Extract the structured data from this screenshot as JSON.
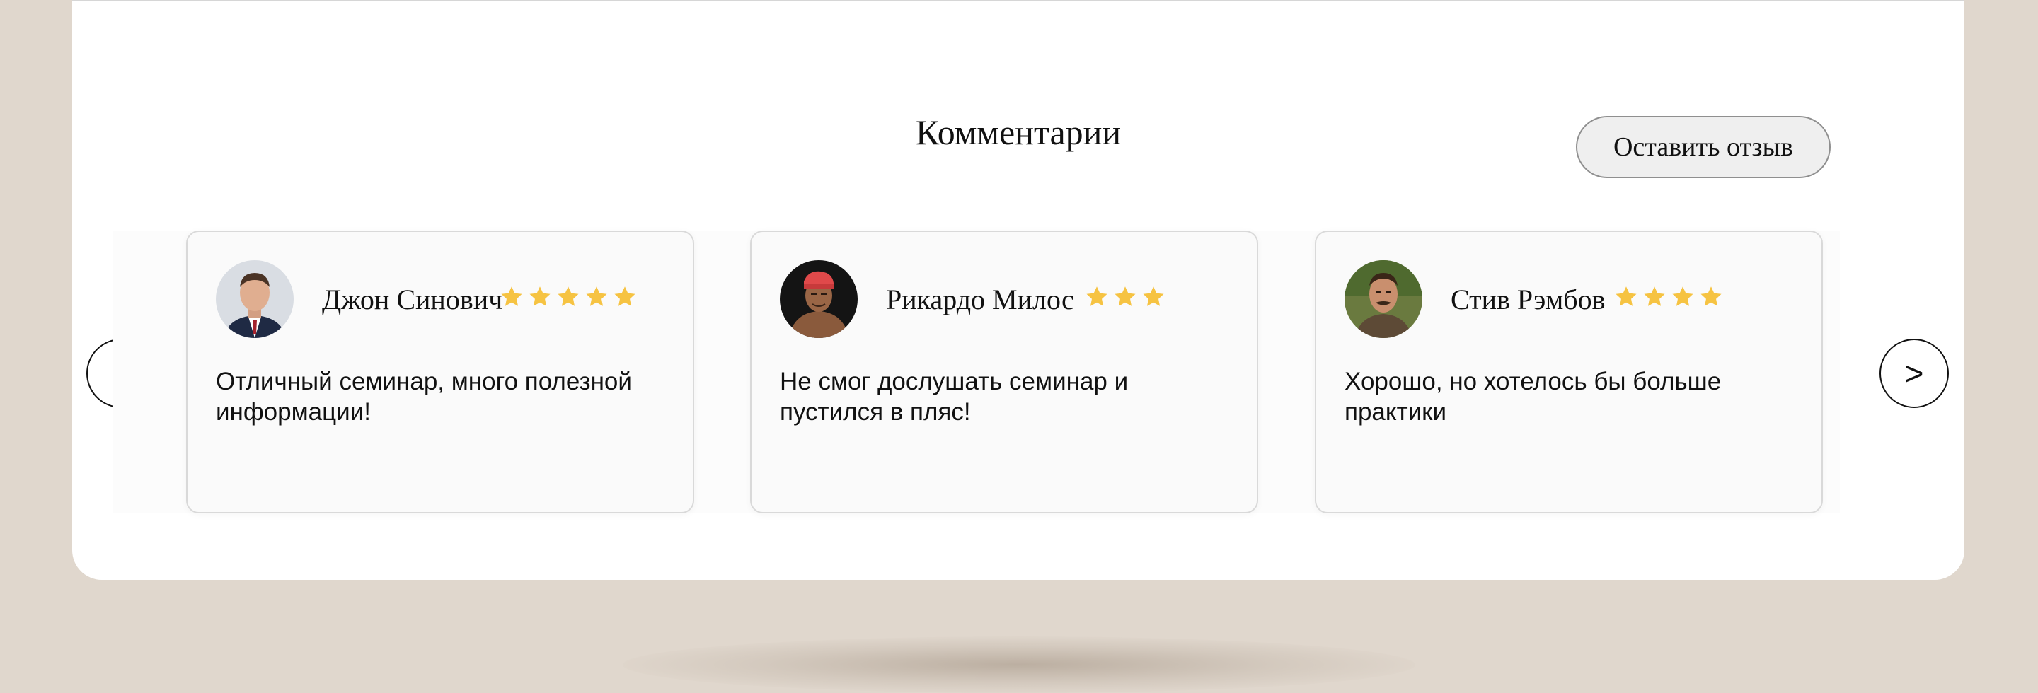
{
  "section": {
    "title": "Комментарии",
    "leave_review_label": "Оставить отзыв"
  },
  "carousel": {
    "prev_label": "<",
    "next_label": ">"
  },
  "reviews": [
    {
      "name": "Джон Синович",
      "rating": 5,
      "comment": "Отличный семинар, много полезной информации!"
    },
    {
      "name": "Рикардо Милос",
      "rating": 3,
      "comment": "Не смог дослушать семинар и пустился в пляс!"
    },
    {
      "name": "Стив Рэмбов",
      "rating": 4,
      "comment": "Хорошо, но хотелось бы больше практики"
    }
  ],
  "colors": {
    "page_background": "#e0d7cd",
    "panel_background": "#ffffff",
    "star": "#f6c342",
    "card_background": "#fafafa"
  },
  "icons": {
    "star": "star-icon",
    "prev": "chevron-left-icon",
    "next": "chevron-right-icon"
  }
}
